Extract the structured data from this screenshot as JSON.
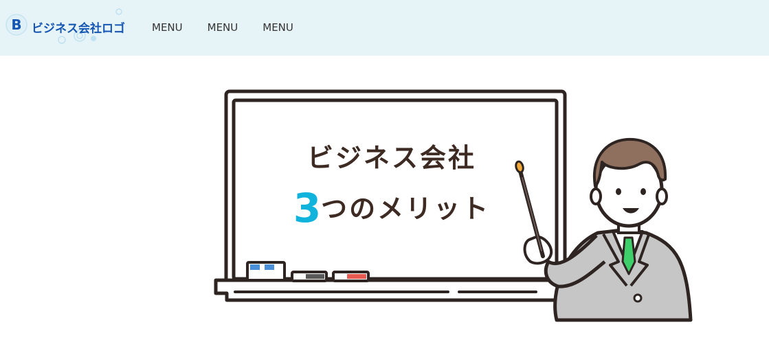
{
  "header": {
    "logo_mark": "B",
    "logo_text": "ビジネス会社ロゴ",
    "menu": [
      {
        "label": "MENU"
      },
      {
        "label": "MENU"
      },
      {
        "label": "MENU"
      }
    ]
  },
  "hero": {
    "title": "ビジネス会社",
    "subtitle_number": "3",
    "subtitle_text": "つのメリット"
  },
  "icons": {
    "logo": "logo-b-icon",
    "illustration": "presenter-illustration"
  },
  "colors": {
    "header_bg": "#e7f4f7",
    "brand_blue": "#1656b3",
    "accent_cyan": "#10b3db",
    "text_dark": "#3d2a22"
  }
}
